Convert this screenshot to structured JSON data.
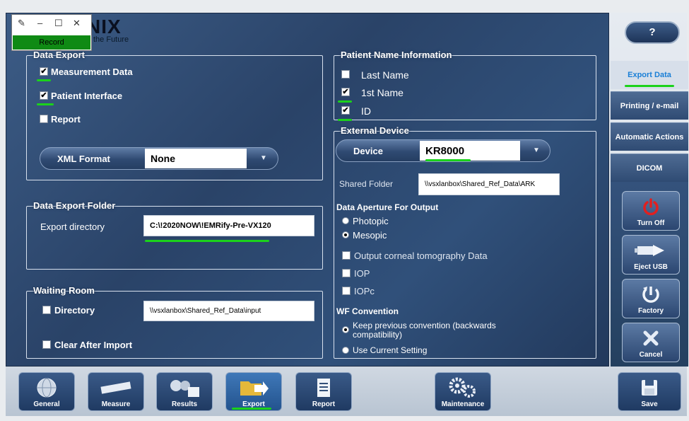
{
  "brand": {
    "logo_text": "NIX",
    "tagline": "the Future"
  },
  "record_window": {
    "minimize": "–",
    "maximize": "☐",
    "close": "✕",
    "button": "Record"
  },
  "data_export": {
    "title": "Data Export",
    "measurement_data": "Measurement Data",
    "patient_interface": "Patient Interface",
    "report": "Report",
    "xml_format_label": "XML Format",
    "xml_format_value": "None"
  },
  "data_export_folder": {
    "title": "Data Export Folder",
    "export_directory_label": "Export directory",
    "export_directory_value": "C:\\!2020NOW\\!EMRify-Pre-VX120"
  },
  "waiting_room": {
    "title": "Waiting Room",
    "directory_label": "Directory",
    "directory_value": "\\\\vsxlanbox\\Shared_Ref_Data\\input",
    "clear_after_import": "Clear After Import"
  },
  "patient_name": {
    "title": "Patient Name Information",
    "last_name": "Last Name",
    "first_name": "1st Name",
    "id": "ID"
  },
  "external_device": {
    "title": "External Device",
    "device_label": "Device",
    "device_value": "KR8000",
    "shared_folder_label": "Shared Folder",
    "shared_folder_value": "\\\\vsxlanbox\\Shared_Ref_Data\\ARK",
    "aperture_title": "Data Aperture For Output",
    "photopic": "Photopic",
    "mesopic": "Mesopic",
    "corneal": "Output corneal tomography Data",
    "iop": "IOP",
    "iopc": "IOPc",
    "wf_title": "WF Convention",
    "keep_previous": "Keep previous convention (backwards compatibility)",
    "use_current": "Use Current Setting"
  },
  "sidebar": {
    "help": "?",
    "tabs": [
      "Export Data",
      "Printing / e-mail",
      "Automatic Actions",
      "DICOM"
    ],
    "buttons": [
      "Turn Off",
      "Eject USB",
      "Factory",
      "Cancel"
    ],
    "save": "Save"
  },
  "bottom_nav": [
    "General",
    "Measure",
    "Results",
    "Export",
    "Report",
    "Maintenance"
  ]
}
